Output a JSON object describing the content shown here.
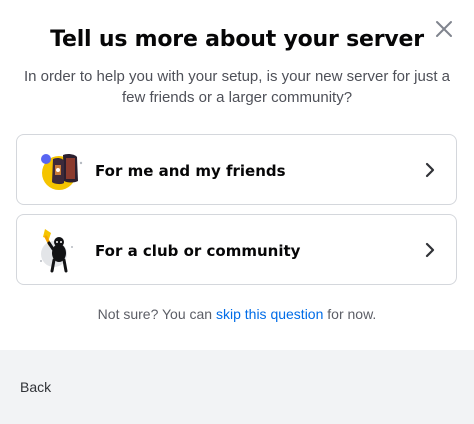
{
  "modal": {
    "title": "Tell us more about your server",
    "subtitle": "In order to help you with your setup, is your new server for just a few friends or a larger community?",
    "options": [
      {
        "label": "For me and my friends",
        "icon": "friends-illustration-icon"
      },
      {
        "label": "For a club or community",
        "icon": "community-illustration-icon"
      }
    ],
    "hint": {
      "prefix": "Not sure? You can ",
      "link": "skip this question",
      "suffix": " for now."
    },
    "footer": {
      "back_label": "Back"
    }
  },
  "colors": {
    "link": "#006ce7",
    "footer_bg": "#f2f3f5",
    "border": "#d4d7dc"
  }
}
